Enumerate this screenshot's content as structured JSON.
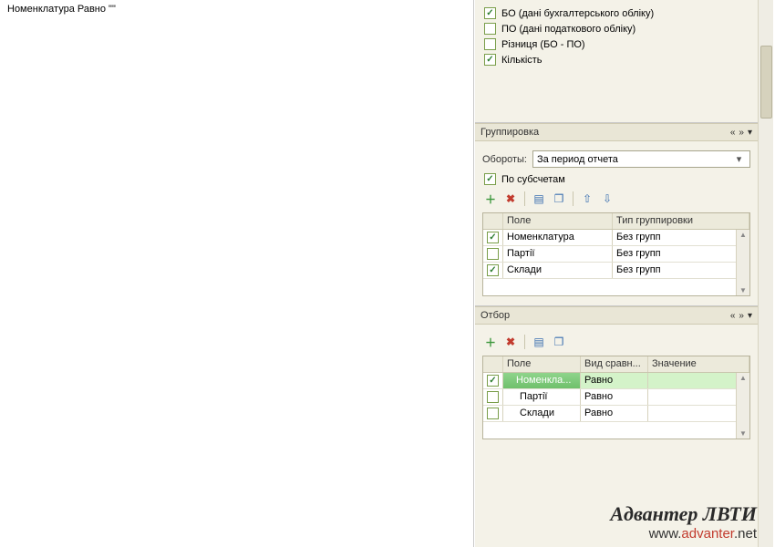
{
  "main": {
    "filter_description": "Номенклатура Равно \"\""
  },
  "data_options": {
    "items": [
      {
        "label": "БО (дані бухгалтерського обліку)",
        "checked": true
      },
      {
        "label": "ПО (дані податкового обліку)",
        "checked": false
      },
      {
        "label": "Різниця (БО - ПО)",
        "checked": false
      },
      {
        "label": "Кількість",
        "checked": true
      }
    ]
  },
  "grouping": {
    "header": "Группировка",
    "turnover_label": "Обороты:",
    "turnover_value": "За период отчета",
    "by_subaccounts_label": "По субсчетам",
    "by_subaccounts_checked": true,
    "columns": {
      "field": "Поле",
      "type": "Тип группировки"
    },
    "rows": [
      {
        "checked": true,
        "field": "Номенклатура",
        "type": "Без групп"
      },
      {
        "checked": false,
        "field": "Партії",
        "type": "Без групп"
      },
      {
        "checked": true,
        "field": "Склади",
        "type": "Без групп"
      }
    ]
  },
  "filter": {
    "header": "Отбор",
    "columns": {
      "field": "Поле",
      "comparison": "Вид сравн...",
      "value": "Значение"
    },
    "rows": [
      {
        "checked": true,
        "field": "Номенкла...",
        "comparison": "Равно",
        "value": "",
        "selected": true
      },
      {
        "checked": false,
        "field": "Партії",
        "comparison": "Равно",
        "value": ""
      },
      {
        "checked": false,
        "field": "Склади",
        "comparison": "Равно",
        "value": ""
      }
    ]
  },
  "watermark": {
    "title": "Адвантер ЛВТИ",
    "url_pre": "www.",
    "url_mid": "advanter",
    "url_post": ".net"
  },
  "glyphs": {
    "left2": "«",
    "right2": "»",
    "down": "▾",
    "add": "＋",
    "del": "✖",
    "page": "▤",
    "pages": "❐",
    "up": "⇧",
    "downarrow": "⇩"
  }
}
